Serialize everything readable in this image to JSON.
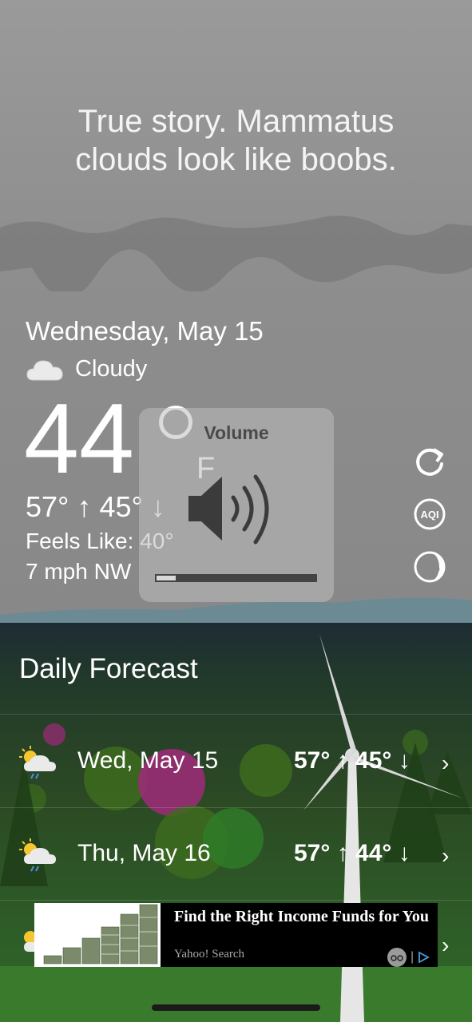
{
  "quip": [
    "True story. Mammatus",
    "clouds look like boobs."
  ],
  "current": {
    "date": "Wednesday, May 15",
    "condition_icon": "cloud-icon",
    "condition": "Cloudy",
    "temp": "44",
    "unit": "F",
    "high_low": "57° ↑ 45° ↓",
    "feels_like": "Feels Like: 40°",
    "wind": "7 mph NW"
  },
  "side_actions": {
    "refresh_icon": "refresh-icon",
    "aqi_icon": "aqi-icon",
    "moon_icon": "moon-phase-icon",
    "aqi_label": "AQI"
  },
  "daily": {
    "title": "Daily Forecast",
    "rows": [
      {
        "icon": "partly-cloudy-rain-icon",
        "day": "Wed, May 15",
        "temps": "57° ↑ 45° ↓"
      },
      {
        "icon": "partly-cloudy-rain-icon",
        "day": "Thu, May 16",
        "temps": "57° ↑ 44° ↓"
      }
    ]
  },
  "ad": {
    "title": "Find the Right Income Funds for You",
    "source": "Yahoo! Search"
  },
  "volume_hud": {
    "label": "Volume",
    "level": 0.12
  },
  "colors": {
    "sky": "#8f8f8f",
    "hud": "#bebebe",
    "ground": "#2f6a2a"
  }
}
